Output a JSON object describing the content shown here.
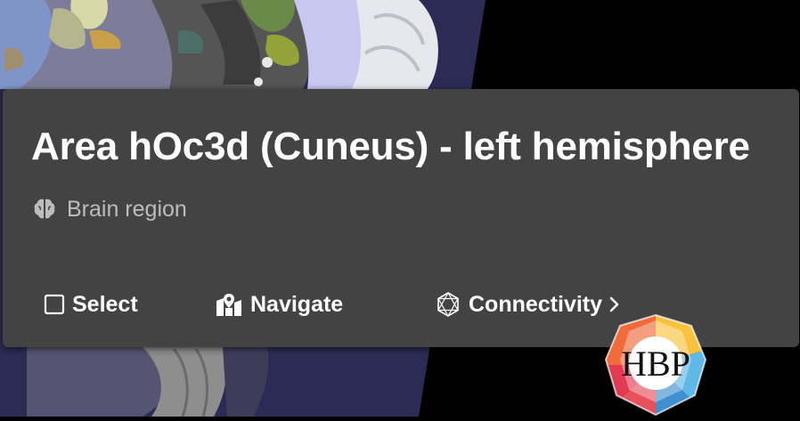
{
  "region_card": {
    "title": "Area hOc3d (Cuneus) - left hemisphere",
    "type_label": "Brain region",
    "type_icon": "brain-icon"
  },
  "actions": {
    "select": {
      "label": "Select",
      "icon": "checkbox-icon"
    },
    "navigate": {
      "label": "Navigate",
      "icon": "map-marker-icon"
    },
    "connectivity": {
      "label": "Connectivity",
      "icon": "connectivity-icon",
      "chevron": "chevron-right-icon"
    }
  },
  "logo": {
    "letters": "HBP",
    "icon": "hbp-logo-icon"
  },
  "colors": {
    "card_background": "#434343",
    "viewer_background": "#000000",
    "text_primary": "#ffffff",
    "text_secondary": "#bdbdbd",
    "slice_background": "#2b2b55"
  }
}
